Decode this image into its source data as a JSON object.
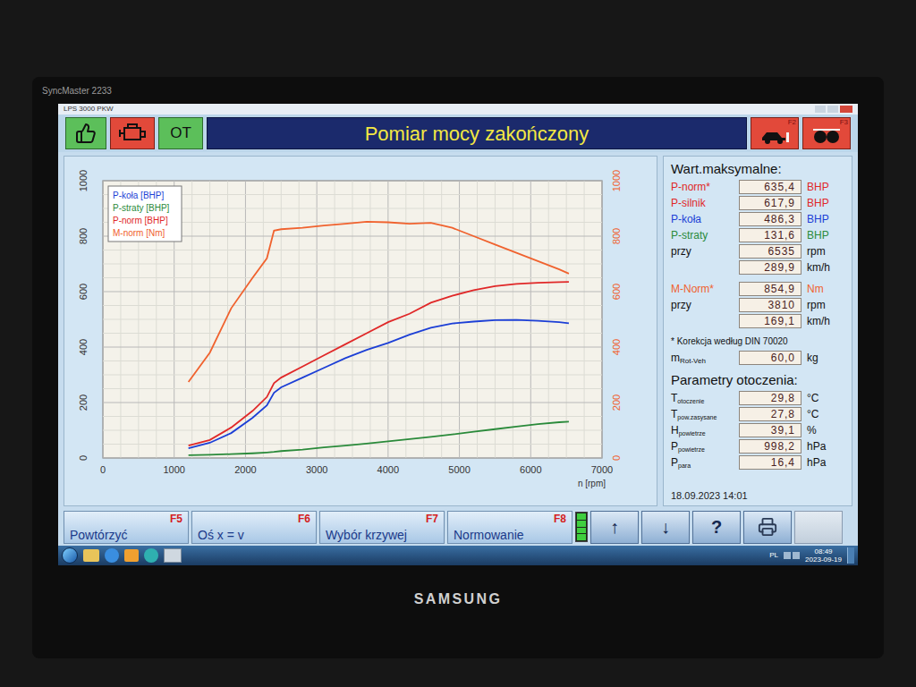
{
  "monitor": {
    "model": "SyncMaster 2233",
    "brand": "SAMSUNG"
  },
  "window": {
    "title": "LPS 3000 PKW"
  },
  "toolbar": {
    "ot_button": "OT",
    "status": "Pomiar mocy zakończony",
    "f_buttons": [
      "F2",
      "F3"
    ]
  },
  "chart": {
    "x_ticks": [
      "0",
      "1000",
      "2000",
      "3000",
      "4000",
      "5000",
      "6000",
      "7000"
    ],
    "x_label": "n [rpm]",
    "y_ticks_left": [
      "0",
      "200",
      "400",
      "600",
      "800",
      "1000"
    ],
    "y_ticks_right": [
      "0",
      "200",
      "400",
      "600",
      "800",
      "1000"
    ],
    "rpm": [
      1200,
      1500,
      1800,
      2100,
      2300,
      2400,
      2500,
      2800,
      3100,
      3400,
      3700,
      4000,
      4300,
      4600,
      4900,
      5200,
      5500,
      5800,
      6100,
      6400,
      6535
    ],
    "series": [
      {
        "name": "P-koła [BHP]",
        "color": "#1c3fd6",
        "values": [
          35,
          55,
          90,
          145,
          190,
          235,
          255,
          290,
          325,
          360,
          390,
          415,
          445,
          470,
          485,
          492,
          497,
          498,
          495,
          490,
          486
        ]
      },
      {
        "name": "P-straty [BHP]",
        "color": "#2a8a3a",
        "values": [
          10,
          12,
          14,
          17,
          20,
          22,
          25,
          30,
          38,
          45,
          52,
          60,
          68,
          76,
          85,
          95,
          104,
          113,
          122,
          129,
          131
        ]
      },
      {
        "name": "P-norm [BHP]",
        "color": "#e02828",
        "values": [
          45,
          65,
          110,
          170,
          220,
          270,
          290,
          330,
          370,
          410,
          450,
          490,
          520,
          560,
          585,
          605,
          620,
          628,
          632,
          634,
          635
        ]
      },
      {
        "name": "M-norm [Nm]",
        "color": "#f0622e",
        "values": [
          274,
          380,
          540,
          650,
          720,
          820,
          825,
          830,
          838,
          845,
          852,
          850,
          845,
          848,
          830,
          800,
          770,
          740,
          710,
          680,
          665
        ]
      }
    ]
  },
  "max_values": {
    "title": "Wart.maksymalne:",
    "groups": [
      {
        "rows": [
          {
            "label": "P-norm*",
            "value": "635,4",
            "unit": "BHP",
            "color": "#e02828"
          },
          {
            "label": "P-silnik",
            "value": "617,9",
            "unit": "BHP",
            "color": "#e02828"
          },
          {
            "label": "P-koła",
            "value": "486,3",
            "unit": "BHP",
            "color": "#1c3fd6"
          },
          {
            "label": "P-straty",
            "value": "131,6",
            "unit": "BHP",
            "color": "#2a8a3a"
          },
          {
            "label": "przy",
            "value": "6535",
            "unit": "rpm",
            "color": "#111111"
          },
          {
            "label": "",
            "value": "289,9",
            "unit": "km/h",
            "color": "#111111"
          }
        ]
      },
      {
        "rows": [
          {
            "label": "M-Norm*",
            "value": "854,9",
            "unit": "Nm",
            "color": "#f0622e"
          },
          {
            "label": "przy",
            "value": "3810",
            "unit": "rpm",
            "color": "#111111"
          },
          {
            "label": "",
            "value": "169,1",
            "unit": "km/h",
            "color": "#111111"
          }
        ]
      }
    ],
    "note": "* Korekcja według DIN 70020",
    "mass": {
      "symbol": "m",
      "sub": "Rot-Veh",
      "value": "60,0",
      "unit": "kg"
    }
  },
  "ambient": {
    "title": "Parametry otoczenia:",
    "rows": [
      {
        "symbol": "T",
        "sub": "otoczenie",
        "value": "29,8",
        "unit": "°C"
      },
      {
        "symbol": "T",
        "sub": "pow.zasysane",
        "value": "27,8",
        "unit": "°C"
      },
      {
        "symbol": "H",
        "sub": "powietrze",
        "value": "39,1",
        "unit": "%"
      },
      {
        "symbol": "P",
        "sub": "powietrze",
        "value": "998,2",
        "unit": "hPa"
      },
      {
        "symbol": "P",
        "sub": "para",
        "value": "16,4",
        "unit": "hPa"
      }
    ]
  },
  "timestamp": "18.09.2023 14:01",
  "function_keys": [
    {
      "label": "Powtórzyć",
      "key": "F5"
    },
    {
      "label": "Oś x = v",
      "key": "F6"
    },
    {
      "label": "Wybór krzywej",
      "key": "F7"
    },
    {
      "label": "Normowanie",
      "key": "F8"
    }
  ],
  "indicator": {
    "level": 1
  },
  "nav_buttons": [
    "↑",
    "↓",
    "?"
  ],
  "taskbar": {
    "lang": "PL",
    "time": "08:49",
    "date": "2023-09-19"
  }
}
